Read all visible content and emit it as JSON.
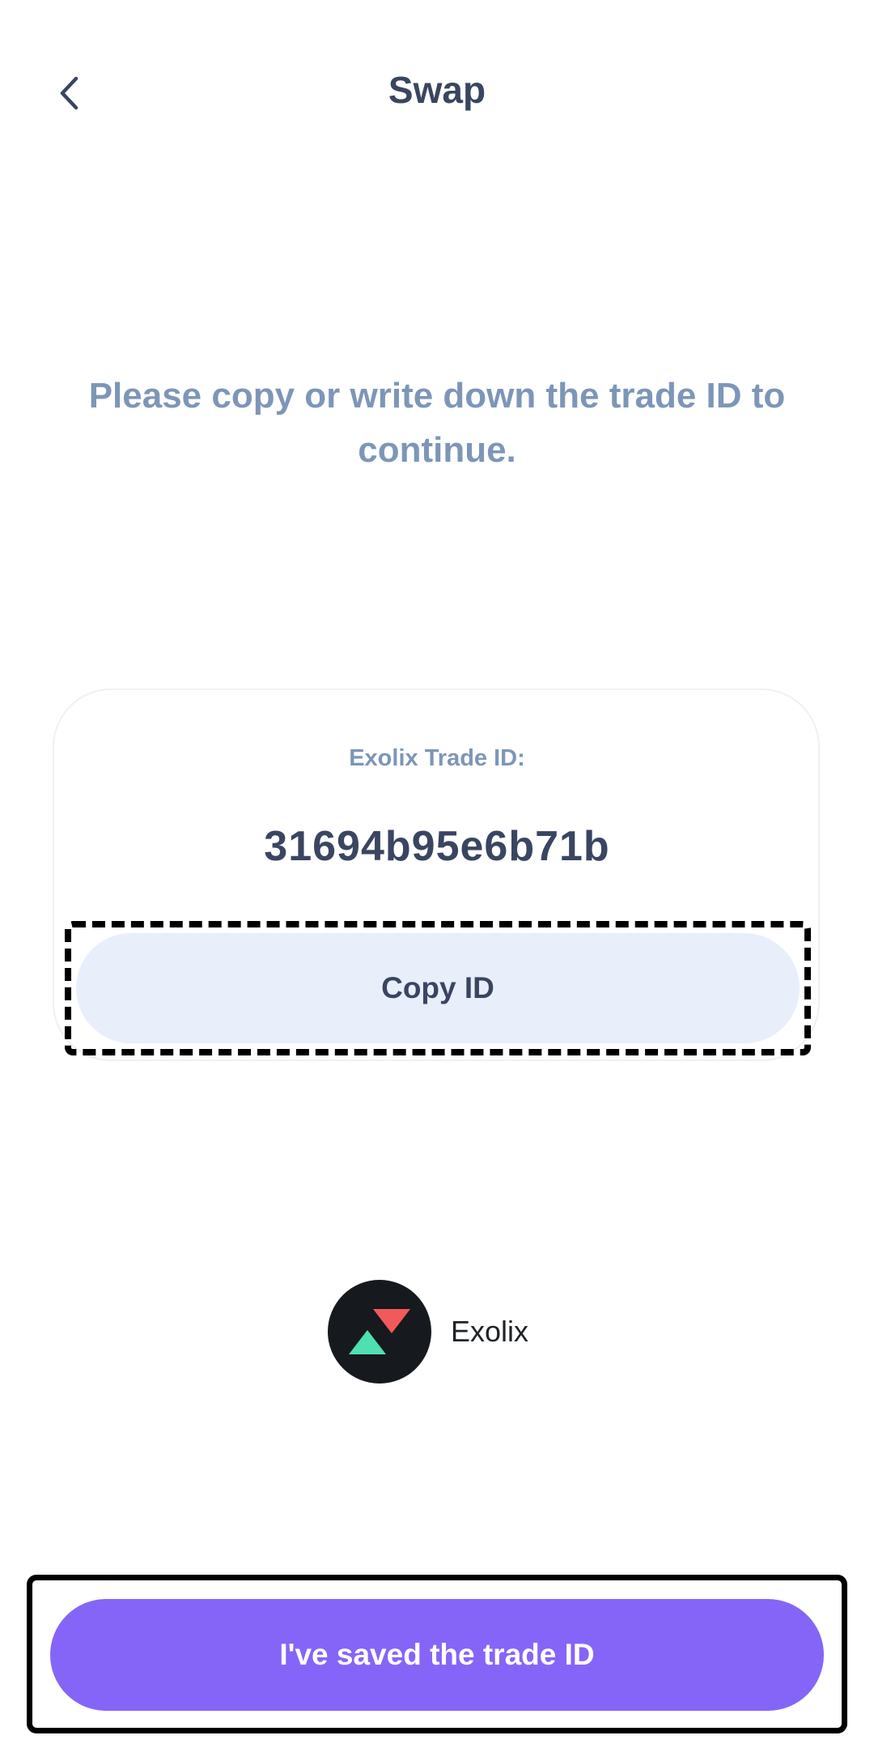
{
  "header": {
    "title": "Swap",
    "back_icon": "chevron-left-icon"
  },
  "instruction": "Please copy or write down the trade ID to continue.",
  "trade_card": {
    "label": "Exolix Trade ID:",
    "trade_id": "31694b95e6b71b",
    "copy_button_label": "Copy ID"
  },
  "provider": {
    "name": "Exolix",
    "logo_icon": "exolix-logo-icon",
    "logo_colors": {
      "background": "#16191d",
      "top_triangle": "#f05a5a",
      "bottom_triangle": "#4ee0b0"
    }
  },
  "footer": {
    "save_button_label": "I've saved the trade ID",
    "accent_color": "#8565f8"
  }
}
